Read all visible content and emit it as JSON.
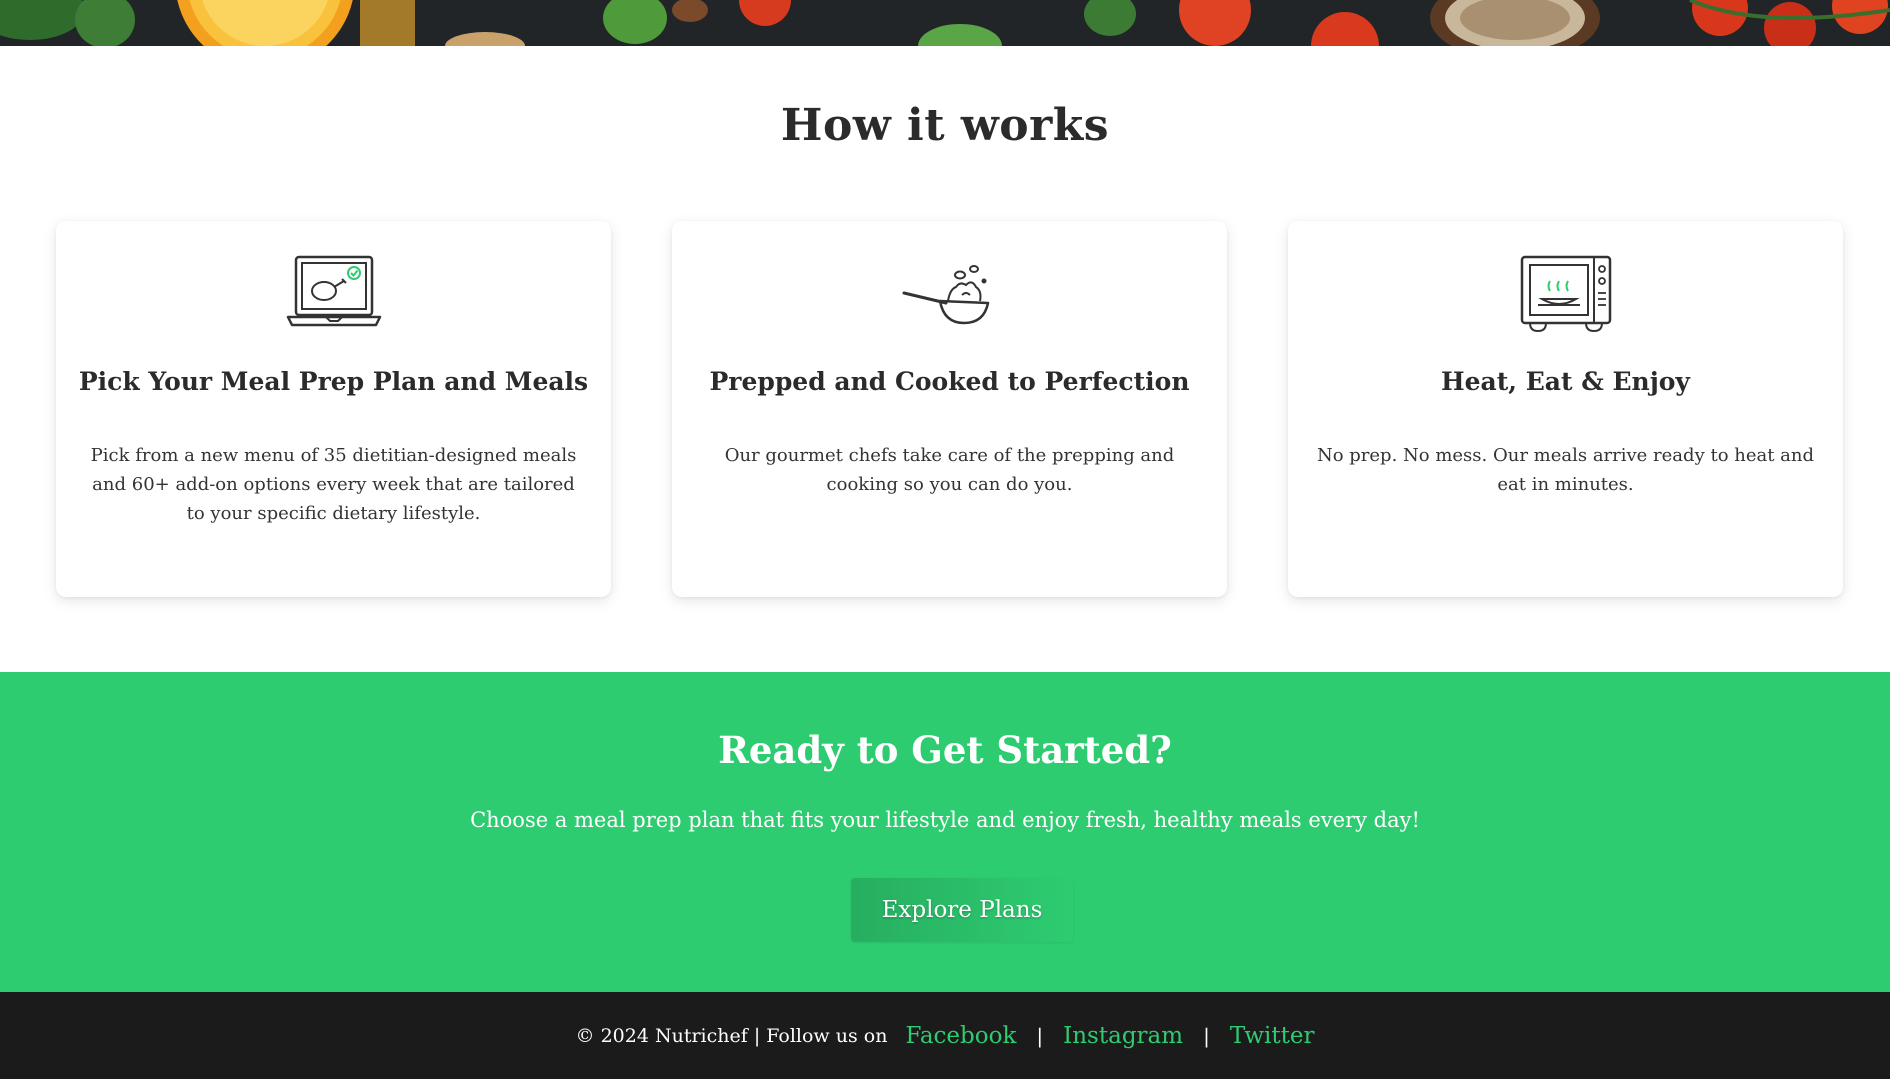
{
  "banner": {
    "alt": ""
  },
  "how_it_works": {
    "title": "How it works",
    "cards": [
      {
        "icon": "laptop-chicken-icon",
        "title": "Pick Your Meal Prep Plan and Meals",
        "text": "Pick from a new menu of 35 dietitian-designed meals and 60+ add-on options every week that are tailored to your specific dietary lifestyle."
      },
      {
        "icon": "pan-cooking-icon",
        "title": "Prepped and Cooked to Perfection",
        "text": "Our gourmet chefs take care of the prepping and cooking so you can do you."
      },
      {
        "icon": "microwave-icon",
        "title": "Heat, Eat & Enjoy",
        "text": "No prep. No mess. Our meals arrive ready to heat and eat in minutes."
      }
    ]
  },
  "cta": {
    "title": "Ready to Get Started?",
    "text": "Choose a meal prep plan that fits your lifestyle and enjoy fresh, healthy meals every day!",
    "button_label": "Explore Plans"
  },
  "footer": {
    "copyright": "© 2024 Nutrichef | Follow us on",
    "links": [
      "Facebook",
      "Instagram",
      "Twitter"
    ],
    "separator": "|"
  },
  "colors": {
    "accent": "#2ecc71",
    "footer_bg": "#1b1b1b",
    "text": "#2b2b2b"
  }
}
